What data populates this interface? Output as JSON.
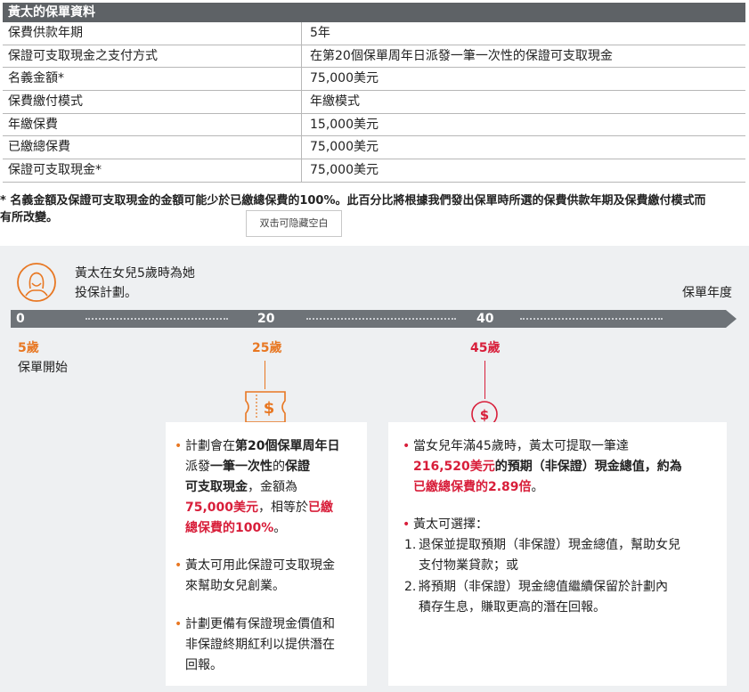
{
  "table": {
    "title": "黃太的保單資料",
    "rows": [
      {
        "label": "保費供款年期",
        "value": "5年"
      },
      {
        "label": "保證可支取現金之支付方式",
        "value": "在第20個保單周年日派發一筆一次性的保證可支取現金"
      },
      {
        "label": "名義金額*",
        "value": "75,000美元"
      },
      {
        "label": "保費繳付模式",
        "value": "年繳模式"
      },
      {
        "label": "年繳保費",
        "value": "15,000美元"
      },
      {
        "label": "已繳總保費",
        "value": "75,000美元"
      },
      {
        "label": "保證可支取現金*",
        "value": "75,000美元"
      }
    ]
  },
  "footnote": {
    "line1": "* 名義金額及保證可支取現金的金額可能少於已繳總保費的100%。此百分比將根據我們發出保單時所選的保費供款年期及保費繳付模式而",
    "line2": "有所改變。"
  },
  "hide_button": "双击可隐藏空白",
  "timeline": {
    "intro_line1": "黃太在女兒5歲時為她",
    "intro_line2": "投保計劃。",
    "axis_label": "保單年度",
    "ticks": [
      "0",
      "20",
      "40"
    ],
    "ages": [
      "5歲",
      "25歲",
      "45歲"
    ],
    "start_label": "保單開始",
    "icons": [
      "person-icon",
      "ticket-dollar-icon",
      "coin-dollar-icon"
    ]
  },
  "card1": {
    "b1": {
      "l1a": "計劃會在",
      "l1b": "第20個保單周年日",
      "l2a": "派發",
      "l2b": "一筆一次性",
      "l2c": "的",
      "l2d": "保證",
      "l3a": "可支取現金",
      "l3b": "，金額為",
      "l4a": "75,000美元",
      "l4b": "，相等於",
      "l4c": "已繳",
      "l5a": "總保費的100%",
      "l5b": "。"
    },
    "b2": {
      "l1": "黃太可用此保證可支取現金",
      "l2": "來幫助女兒創業。"
    },
    "b3": {
      "l1": "計劃更備有保證現金價值和",
      "l2": "非保證終期紅利以提供潛在",
      "l3": "回報。"
    }
  },
  "card2": {
    "b1": {
      "l1": "當女兒年滿45歲時，黃太可提取一筆達",
      "l2a": "216,520美元",
      "l2b": "的預期（非保證）現金總值，約為",
      "l3": "已繳總保費的2.89倍",
      "l3b": "。"
    },
    "b2": {
      "l1": "黃太可選擇：",
      "o1_num": "1.",
      "o1_l1": "退保並提取預期（非保證）現金總值，幫助女兒",
      "o1_l2": "支付物業貸款；或",
      "o2_num": "2.",
      "o2_l1": "將預期（非保證）現金總值繼續保留於計劃內",
      "o2_l2": "積存生息，賺取更高的潛在回報。"
    }
  },
  "colors": {
    "orange": "#e87722",
    "red": "#d81e3a",
    "bar": "#6e7378",
    "panel": "#eef0f2"
  }
}
